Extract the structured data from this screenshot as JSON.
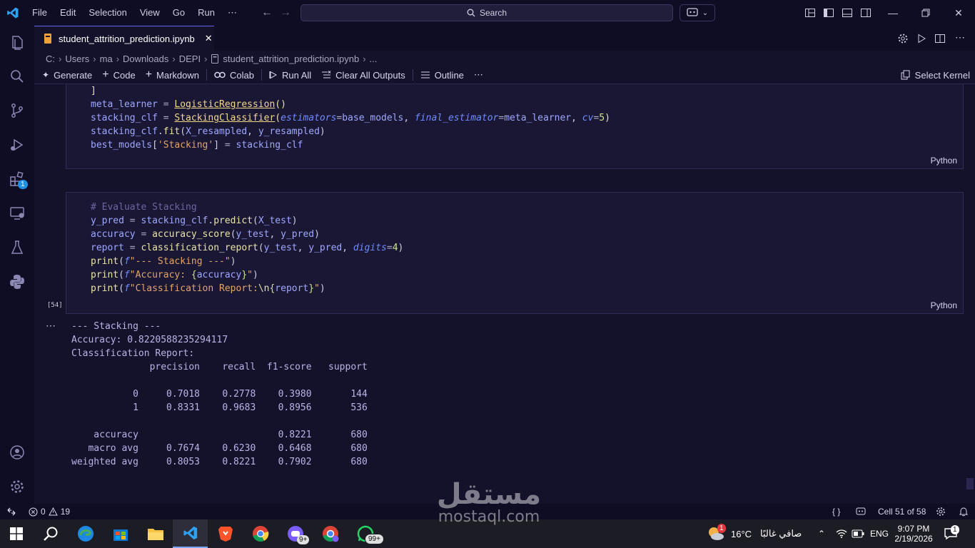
{
  "menu": [
    "File",
    "Edit",
    "Selection",
    "View",
    "Go",
    "Run",
    "⋯"
  ],
  "search": {
    "label": "Search"
  },
  "tab": {
    "title": "student_attrition_prediction.ipynb"
  },
  "breadcrumb": [
    "C:",
    "Users",
    "ma",
    "Downloads",
    "DEPI",
    "student_attrition_prediction.ipynb",
    "..."
  ],
  "toolbar": {
    "generate": "Generate",
    "code": "Code",
    "markdown": "Markdown",
    "colab": "Colab",
    "run_all": "Run All",
    "clear_all": "Clear All Outputs",
    "outline": "Outline",
    "more": "⋯",
    "select_kernel": "Select Kernel"
  },
  "activity": {
    "extensions_badge": "1"
  },
  "cell1": {
    "lines": [
      "    ]",
      "    meta_learner = LogisticRegression()",
      "    stacking_clf = StackingClassifier(estimators=base_models, final_estimator=meta_learner, cv=5)",
      "    stacking_clf.fit(X_resampled, y_resampled)",
      "    best_models['Stacking'] = stacking_clf"
    ],
    "language": "Python"
  },
  "cell2": {
    "lines": [
      "# Evaluate Stacking",
      "y_pred = stacking_clf.predict(X_test)",
      "accuracy = accuracy_score(y_test, y_pred)",
      "report = classification_report(y_test, y_pred, digits=4)",
      "print(f\"--- Stacking ---\")",
      "print(f\"Accuracy: {accuracy}\")",
      "print(f\"Classification Report:\\n{report}\")"
    ],
    "exec_count": "[54]",
    "language": "Python"
  },
  "output": {
    "more": "⋯",
    "lines": [
      "--- Stacking ---",
      "Accuracy: 0.8220588235294117",
      "Classification Report:",
      "              precision    recall  f1-score   support",
      "",
      "           0     0.7018    0.2778    0.3980       144",
      "           1     0.8331    0.9683    0.8956       536",
      "",
      "    accuracy                         0.8221       680",
      "   macro avg     0.7674    0.6230    0.6468       680",
      "weighted avg     0.8053    0.8221    0.7902       680"
    ]
  },
  "status": {
    "errors": "0",
    "warnings": "19",
    "braces": "{ }",
    "cell_position": "Cell 51 of 58"
  },
  "taskbar": {
    "copilot_badge": "9+",
    "whatsapp_badge": "99+",
    "weather_temp": "16°C",
    "weather_text": "صافي غالبًا",
    "weather_badge": "1",
    "lang": "ENG",
    "time": "9:07 PM",
    "date": "2/19/2026",
    "notif_badge": "1"
  },
  "watermark": {
    "arabic": "مستقل",
    "latin": "mostaql.com"
  },
  "colors": {
    "accent": "#6c63ff",
    "bg": "#14112b",
    "bars": "#0f0d24",
    "vscode_blue": "#1f8fe8"
  }
}
